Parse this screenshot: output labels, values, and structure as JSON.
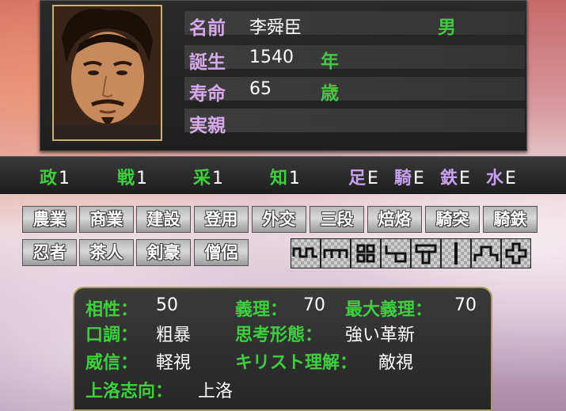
{
  "profile": {
    "name_label": "名前",
    "name": "李舜臣",
    "gender": "男",
    "birth_label": "誕生",
    "birth_year": "1540",
    "birth_unit": "年",
    "life_label": "寿命",
    "life": "65",
    "life_unit": "歳",
    "parent_label": "実親",
    "parent": ""
  },
  "stats": {
    "politics_label": "政",
    "politics": "1",
    "war_label": "戦",
    "war": "1",
    "mining_label": "采",
    "mining": "1",
    "intel_label": "知",
    "intel": "1",
    "foot_label": "足",
    "foot": "E",
    "cavalry_label": "騎",
    "cavalry": "E",
    "gun_label": "鉄",
    "gun": "E",
    "navy_label": "水",
    "navy": "E"
  },
  "skills_row1": [
    "農業",
    "商業",
    "建設",
    "登用",
    "外交",
    "三段",
    "焙烙",
    "騎突",
    "騎鉄"
  ],
  "skills_row2": [
    "忍者",
    "茶人",
    "剣豪",
    "僧侶"
  ],
  "formations": [
    "formation-1-icon",
    "formation-2-icon",
    "formation-3-icon",
    "formation-4-icon",
    "formation-5-icon",
    "formation-6-icon",
    "formation-7-icon",
    "formation-8-icon"
  ],
  "traits": {
    "affinity_label": "相性：",
    "affinity": "50",
    "duty_label": "義理：",
    "duty": "70",
    "max_duty_label": "最大義理：",
    "max_duty": "70",
    "tone_label": "口調：",
    "tone": "粗暴",
    "thinking_label": "思考形態：",
    "thinking": "強い革新",
    "prestige_label": "威信：",
    "prestige": "軽視",
    "christian_label": "キリスト理解：",
    "christian": "敵視",
    "capital_label": "上洛志向：",
    "capital": "上洛"
  },
  "colors": {
    "label_purple": "#d7a9ea",
    "label_green": "#3fce3f",
    "frame_gold": "#b09a58"
  }
}
